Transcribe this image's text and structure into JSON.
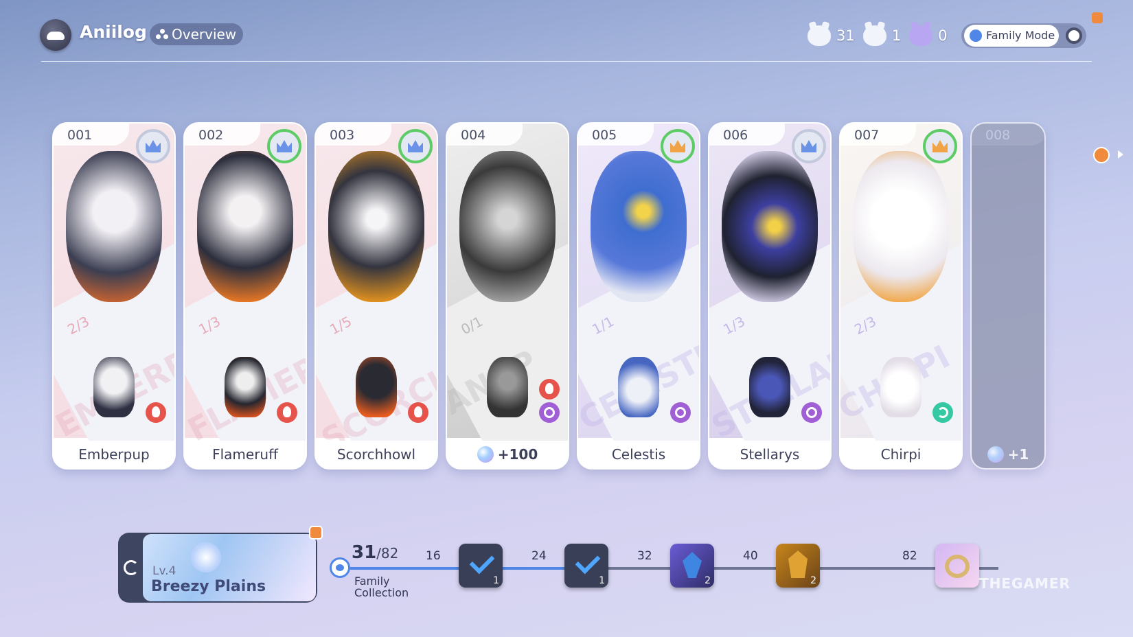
{
  "header": {
    "app_title": "Aniilog",
    "overview_label": "Overview",
    "stats": [
      {
        "icon": "white-monster-icon",
        "value": "31"
      },
      {
        "icon": "white-horned-monster-icon",
        "value": "1"
      },
      {
        "icon": "purple-monster-icon",
        "value": "0"
      }
    ],
    "family_mode_label": "Family Mode"
  },
  "cards": [
    {
      "number": "001",
      "name": "Emberpup",
      "ratio": "2/3",
      "ghost": "EMBERPUP",
      "element": "fire",
      "rank": "blue-crown"
    },
    {
      "number": "002",
      "name": "Flameruff",
      "ratio": "1/3",
      "ghost": "FLAMERUFF",
      "element": "fire",
      "rank": "blue-crown"
    },
    {
      "number": "003",
      "name": "Scorchhowl",
      "ratio": "1/5",
      "ghost": "SCORCHHOWL",
      "element": "fire",
      "rank": "blue-crown"
    },
    {
      "number": "004",
      "name": "",
      "reward": "+100",
      "ratio": "0/1",
      "ghost": "ANUP",
      "element": "fire+void",
      "rank": "none"
    },
    {
      "number": "005",
      "name": "Celestis",
      "ratio": "1/1",
      "ghost": "CELESTIS",
      "element": "void",
      "rank": "gold-crown"
    },
    {
      "number": "006",
      "name": "Stellarys",
      "ratio": "1/3",
      "ghost": "STELLARYS",
      "element": "void",
      "rank": "blue-crown"
    },
    {
      "number": "007",
      "name": "Chirpi",
      "ratio": "2/3",
      "ghost": "CHIRPI",
      "element": "wind",
      "rank": "gold-crown"
    },
    {
      "number": "008",
      "name": "",
      "reward": "+1",
      "locked": true
    }
  ],
  "level": {
    "lv": "Lv.4",
    "name": "Breezy Plains"
  },
  "collection": {
    "current": "31",
    "total": "/82",
    "label": "Family Collection",
    "progress_fraction": 0.378,
    "milestones": [
      {
        "threshold": "16",
        "reward": "checkmark",
        "qty": "1",
        "claimed": true
      },
      {
        "threshold": "24",
        "reward": "checkmark",
        "qty": "1",
        "claimed": true
      },
      {
        "threshold": "32",
        "reward": "blue-crystal",
        "qty": "2",
        "claimed": false
      },
      {
        "threshold": "40",
        "reward": "gold-crystal",
        "qty": "2",
        "claimed": false
      },
      {
        "threshold": "82",
        "reward": "ring",
        "qty": "",
        "claimed": false
      }
    ]
  },
  "watermark": "THEGAMER"
}
